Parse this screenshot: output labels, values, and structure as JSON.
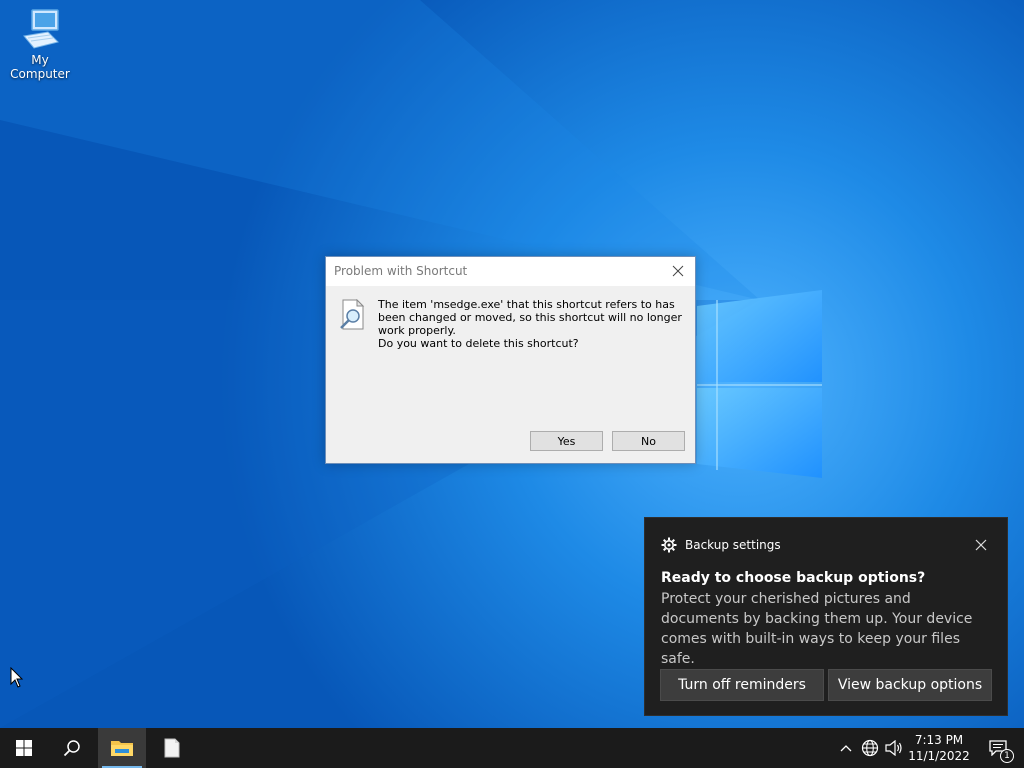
{
  "desktop": {
    "icons": [
      {
        "label": "My Computer",
        "icon": "computer-icon"
      }
    ]
  },
  "dialog": {
    "title": "Problem with Shortcut",
    "message": "The item 'msedge.exe' that this shortcut refers to has been changed or moved, so this shortcut will no longer work properly.",
    "question": "Do you want to delete this shortcut?",
    "yes_label": "Yes",
    "no_label": "No",
    "icon": "magnifier-document-icon"
  },
  "toast": {
    "app_name": "Backup settings",
    "title": "Ready to choose backup options?",
    "body": "Protect your cherished pictures and documents by backing them up. Your device comes with built-in ways to keep your files safe.",
    "button_left": "Turn off reminders",
    "button_right": "View backup options",
    "icon": "gear-icon"
  },
  "taskbar": {
    "clock_time": "7:13 PM",
    "clock_date": "11/1/2022",
    "notification_count": "1",
    "pinned": [
      "start-icon",
      "search-icon",
      "file-explorer-icon",
      "document-icon"
    ],
    "tray": [
      "chevron-up-icon",
      "network-globe-icon",
      "speaker-icon"
    ]
  },
  "colors": {
    "desktop_bg": "#0a6fd6",
    "taskbar_bg": "#1b1b1b",
    "toast_bg": "#1f1f1f",
    "dialog_bg": "#f0f0f0",
    "accent": "#76b9ed"
  }
}
